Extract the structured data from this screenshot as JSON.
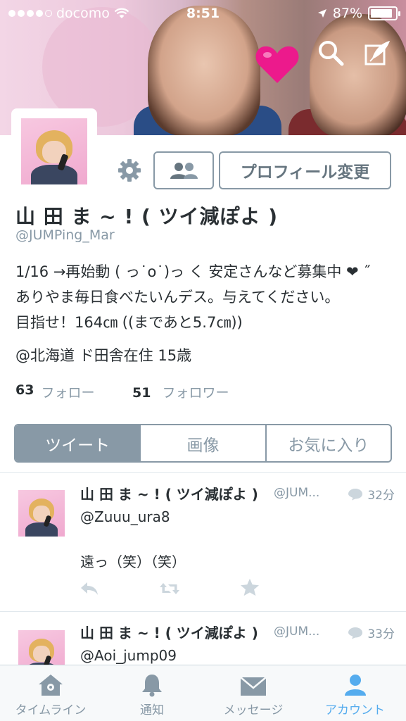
{
  "status_bar": {
    "carrier": "docomo",
    "time": "8:51",
    "battery": "87%",
    "battery_level": 0.87
  },
  "header": {
    "search_icon": "search-icon",
    "compose_icon": "compose-icon"
  },
  "profile": {
    "name": "山 田 ま ~ ! ( ツイ減ぽよ )",
    "handle": "@JUMPing_Mar",
    "edit_button": "プロフィール変更",
    "bio_line1": "1/16 →再始動 ( っ˙o˙)っ く 安定さんなど募集中 ❤︎ ˝",
    "bio_line2": "ありやま毎日食べたいんデス。与えてください。",
    "bio_line3": "目指せ！164㎝ ((まであと5.7㎝))",
    "location": "@北海道 ド田舎在住 15歳",
    "following_count": "63",
    "following_label": "フォロー",
    "followers_count": "51",
    "followers_label": "フォロワー"
  },
  "tabs": [
    {
      "label": "ツイート",
      "active": true
    },
    {
      "label": "画像",
      "active": false
    },
    {
      "label": "お気に入り",
      "active": false
    }
  ],
  "tweets": [
    {
      "name": "山 田 ま ~ ! ( ツイ減ぽよ )",
      "handle": "@JUM...",
      "time": "32分",
      "line1": "@Zuuu_ura8",
      "line2": "遠っ（笑）（笑）"
    },
    {
      "name": "山 田 ま ~ ! ( ツイ減ぽよ )",
      "handle": "@JUM...",
      "time": "33分",
      "line1": "@Aoi_jump09"
    }
  ],
  "tabbar": [
    {
      "label": "タイムライン",
      "icon": "home-icon",
      "active": false
    },
    {
      "label": "通知",
      "icon": "bell-icon",
      "active": false
    },
    {
      "label": "メッセージ",
      "icon": "envelope-icon",
      "active": false
    },
    {
      "label": "アカウント",
      "icon": "person-icon",
      "active": true
    }
  ],
  "colors": {
    "accent": "#55acee",
    "muted": "#8899a6",
    "text": "#292f33"
  }
}
